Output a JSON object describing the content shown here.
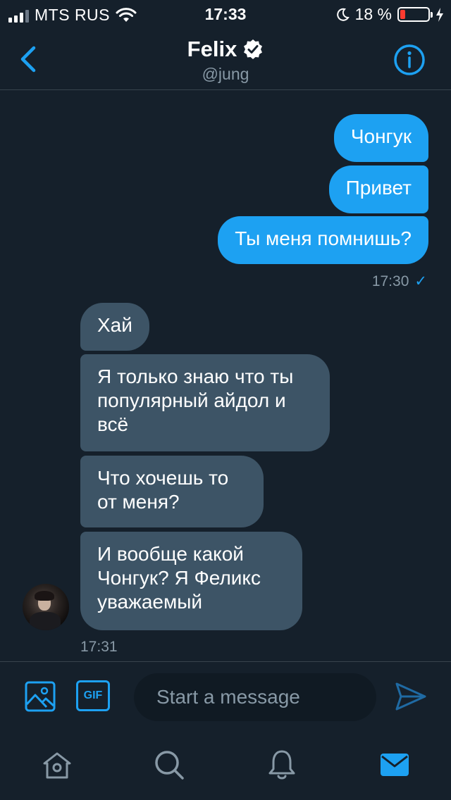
{
  "status_bar": {
    "carrier": "MTS RUS",
    "time": "17:33",
    "battery_percent": "18 %",
    "battery_level": 0.18,
    "colors": {
      "battery_low": "#ff3b30"
    }
  },
  "header": {
    "title": "Felix",
    "handle": "@jung",
    "back_icon": "chevron-left-icon",
    "verified_icon": "verified-badge-icon",
    "info_icon": "info-icon"
  },
  "messages": {
    "outgoing": [
      {
        "text": "Чонгук"
      },
      {
        "text": "Привет"
      },
      {
        "text": "Ты меня помнишь?"
      }
    ],
    "outgoing_time": "17:30",
    "outgoing_status": "✓",
    "incoming": [
      {
        "text": "Хай"
      },
      {
        "text": "Я только знаю что ты популярный айдол и всё"
      },
      {
        "text": "Что хочешь то от меня?"
      },
      {
        "text": "И вообще какой Чонгук? Я Феликс уважаемый"
      }
    ],
    "incoming_time": "17:31"
  },
  "composer": {
    "placeholder": "Start a message",
    "value": "",
    "gif_label": "GIF",
    "image_icon": "image-icon",
    "send_icon": "send-icon"
  },
  "tabbar": {
    "items": [
      {
        "icon": "home-icon",
        "active": false
      },
      {
        "icon": "search-icon",
        "active": false
      },
      {
        "icon": "bell-icon",
        "active": false
      },
      {
        "icon": "mail-icon",
        "active": true
      }
    ]
  },
  "colors": {
    "background": "#15202b",
    "accent": "#1da1f2",
    "incoming_bubble": "#3d5466",
    "secondary_text": "#8899a6",
    "divider": "#38444d"
  }
}
